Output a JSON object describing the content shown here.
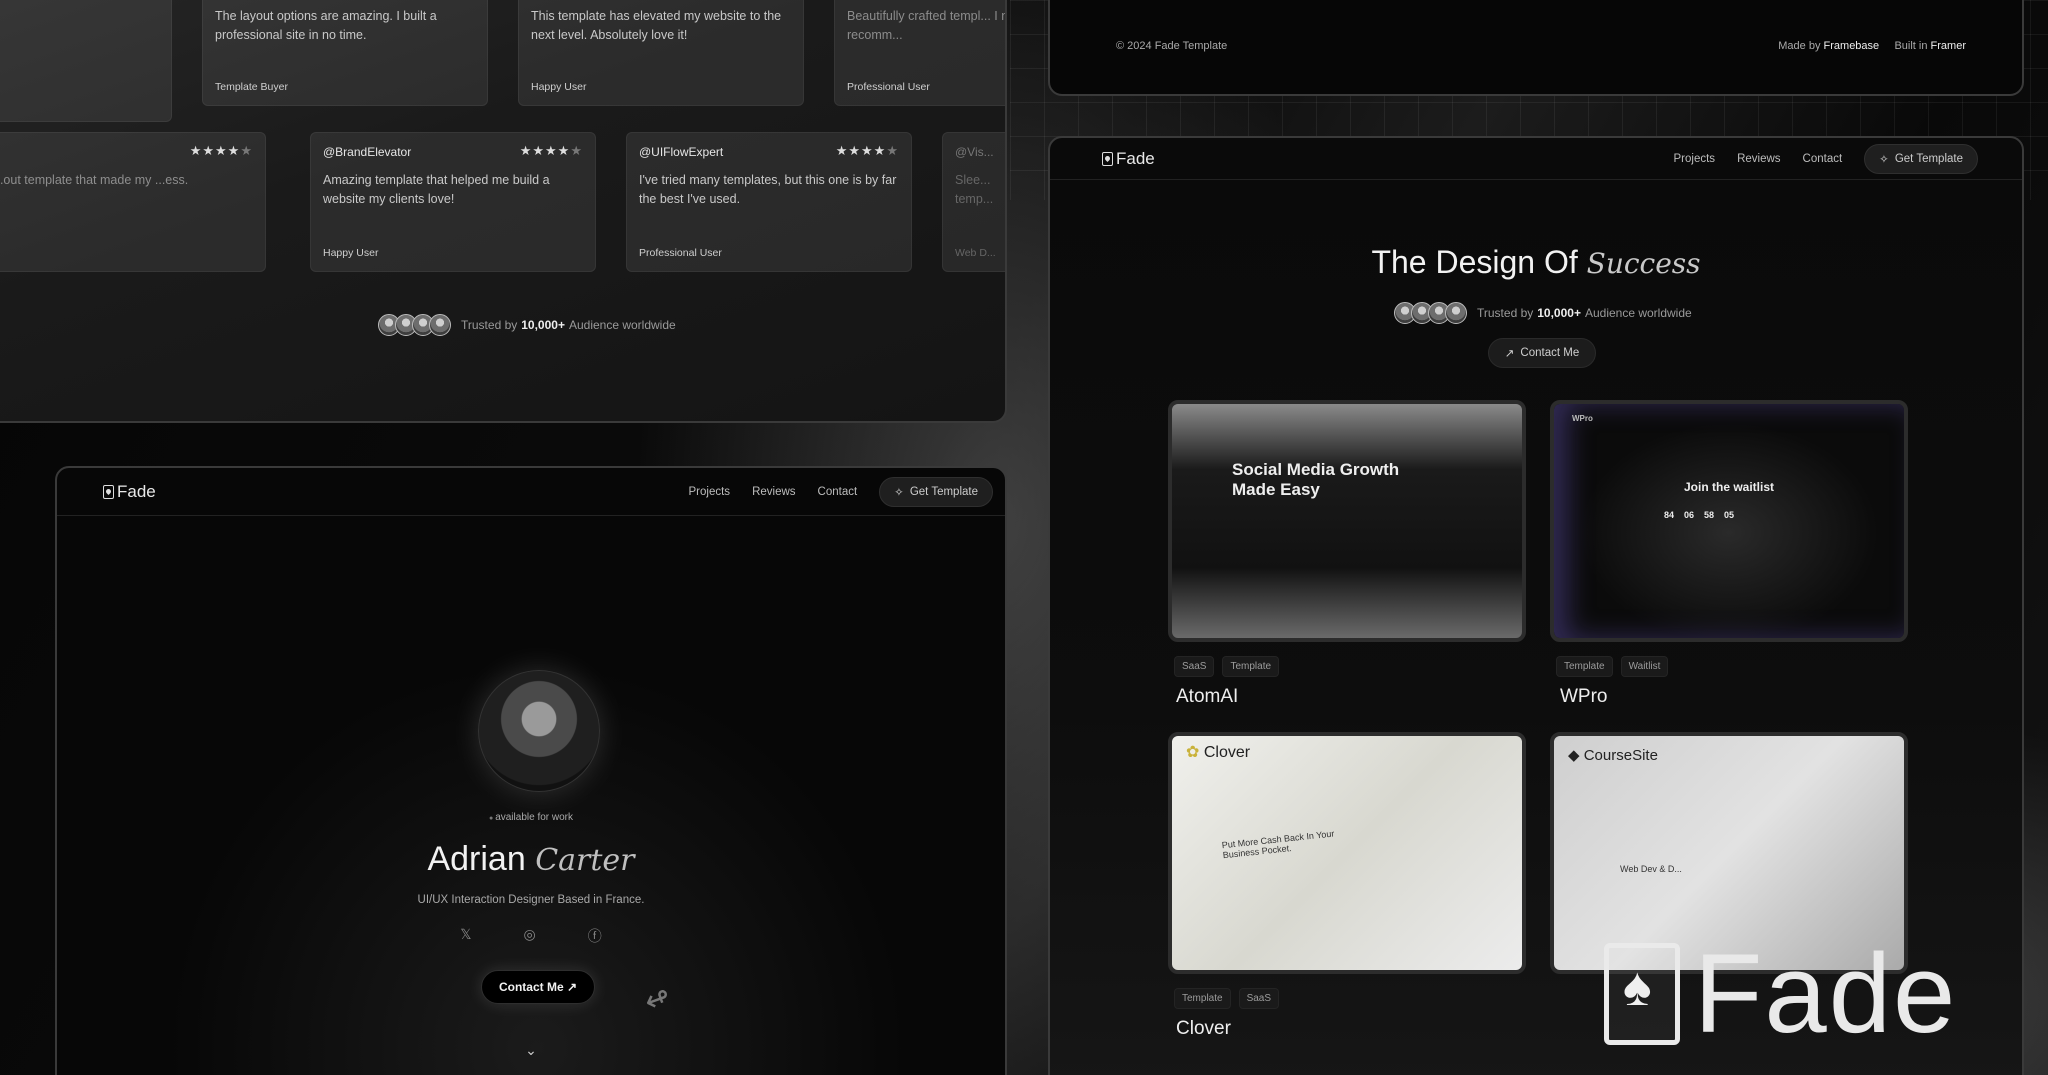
{
  "reviews": {
    "top_row": [
      {
        "text": "The layout options are amazing. I built a professional site in no time.",
        "role": "Template Buyer"
      },
      {
        "text": "This template has elevated my website to the next level. Absolutely love it!",
        "role": "Happy User"
      },
      {
        "text": "Beautifully crafted templ... I needed. Highly recomm...",
        "role": "Professional User"
      }
    ],
    "bottom_row": [
      {
        "handle": "",
        "stars": "★★★★",
        "star_off": "★",
        "text": "...out template that made my ...ess.",
        "role": ""
      },
      {
        "handle": "@BrandElevator",
        "stars": "★★★★",
        "star_off": "★",
        "text": "Amazing template that helped me build a website my clients love!",
        "role": "Happy User"
      },
      {
        "handle": "@UIFlowExpert",
        "stars": "★★★★",
        "star_off": "★",
        "text": "I've tried many templates, but this one is by far the best I've used.",
        "role": "Professional User"
      },
      {
        "handle": "@Vis...",
        "stars": "",
        "star_off": "",
        "text": "Slee... temp...",
        "role": "Web D..."
      }
    ],
    "trust_prefix": "Trusted by",
    "trust_count": "10,000+",
    "trust_suffix": "Audience worldwide"
  },
  "nav": {
    "logo": "Fade",
    "links": [
      "Projects",
      "Reviews",
      "Contact"
    ],
    "cta": "Get Template",
    "cta_icon": "sparkle-icon"
  },
  "profile": {
    "status": "available for work",
    "first_name": "Adrian",
    "last_name": "Carter",
    "subtitle": "UI/UX Interaction Designer Based in France.",
    "socials": [
      "x-icon",
      "instagram-icon",
      "facebook-icon"
    ],
    "social_glyphs": [
      "𝕏",
      "◎",
      "ⓕ"
    ],
    "contact": "Contact Me ↗"
  },
  "footer": {
    "copyright": "© 2024 Fade Template",
    "made_by_label": "Made by",
    "made_by": "Framebase",
    "built_in_label": "Built in",
    "built_in": "Framer"
  },
  "projects": {
    "title_plain": "The Design Of",
    "title_italic": "Success",
    "trust_prefix": "Trusted by",
    "trust_count": "10,000+",
    "trust_suffix": "Audience worldwide",
    "contact": "Contact Me",
    "items": [
      {
        "name": "AtomAI",
        "tags": [
          "SaaS",
          "Template"
        ],
        "preview_text": "Social Media Growth Made Easy"
      },
      {
        "name": "WPro",
        "tags": [
          "Template",
          "Waitlist"
        ],
        "preview_text": "Join the waitlist",
        "countdown": [
          "84",
          "06",
          "58",
          "05"
        ]
      },
      {
        "name": "Clover",
        "tags": [
          "Template",
          "SaaS"
        ],
        "preview_text": "Put More Cash Back In Your Business Pocket.",
        "preview_logo": "Clover"
      },
      {
        "name": "CourseSite",
        "tags": [],
        "preview_text": "Web Dev & D...",
        "preview_logo": "CourseSite"
      }
    ]
  },
  "brand": {
    "wordmark": "Fade"
  }
}
